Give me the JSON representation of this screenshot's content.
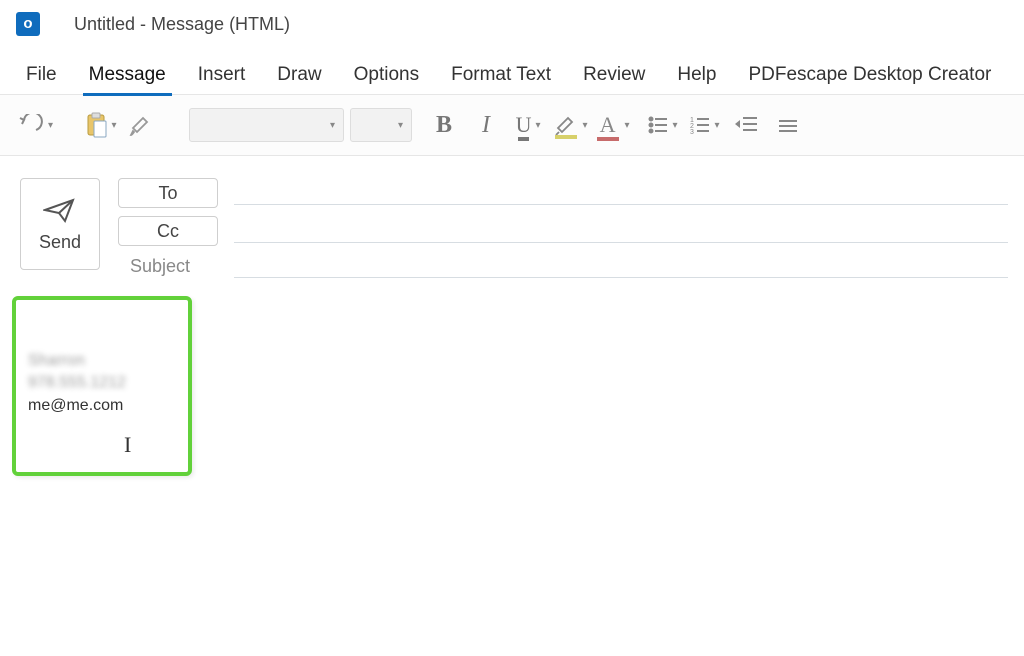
{
  "window": {
    "app_glyph": "o",
    "title": "Untitled  -  Message (HTML)"
  },
  "ribbon": {
    "tabs": [
      "File",
      "Message",
      "Insert",
      "Draw",
      "Options",
      "Format Text",
      "Review",
      "Help",
      "PDFescape Desktop Creator"
    ],
    "active_index": 1
  },
  "toolbar": {
    "bold": "B",
    "italic": "I",
    "underline": "U",
    "font_color_letter": "A"
  },
  "compose": {
    "send_label": "Send",
    "to_label": "To",
    "cc_label": "Cc",
    "subject_label": "Subject",
    "to_value": "",
    "cc_value": "",
    "subject_value": ""
  },
  "signature": {
    "name_blurred": "Sharron",
    "phone_blurred": "978.555.1212",
    "email": "me@me.com"
  }
}
